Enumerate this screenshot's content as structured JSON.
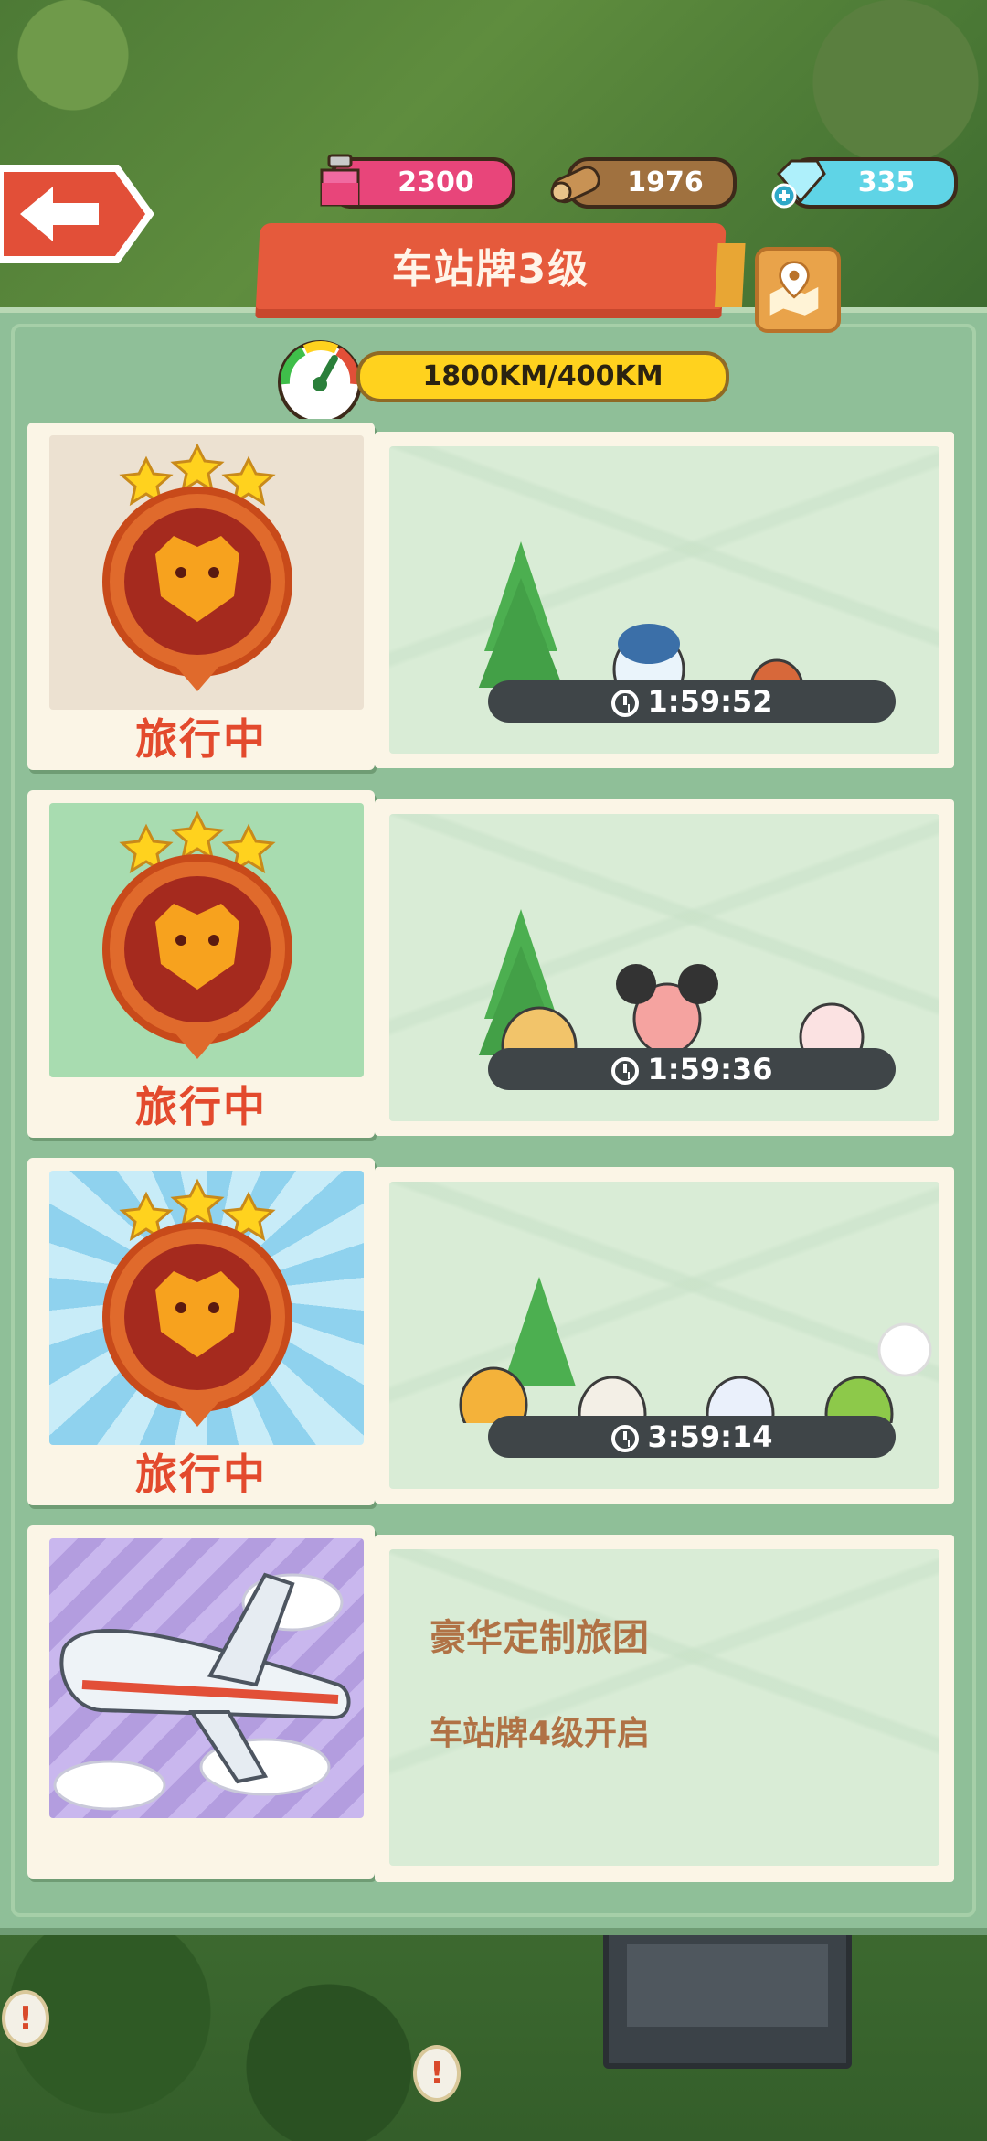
{
  "resources": {
    "ink": "2300",
    "wood": "1976",
    "gems": "335"
  },
  "title": "车站牌3级",
  "speed": "1800KM/400KM",
  "cards": [
    {
      "status": "旅行中",
      "timer": "1:59:52"
    },
    {
      "status": "旅行中",
      "timer": "1:59:36"
    },
    {
      "status": "旅行中",
      "timer": "3:59:14"
    }
  ],
  "locked": {
    "title": "豪华定制旅团",
    "subtitle": "车站牌4级开启"
  }
}
